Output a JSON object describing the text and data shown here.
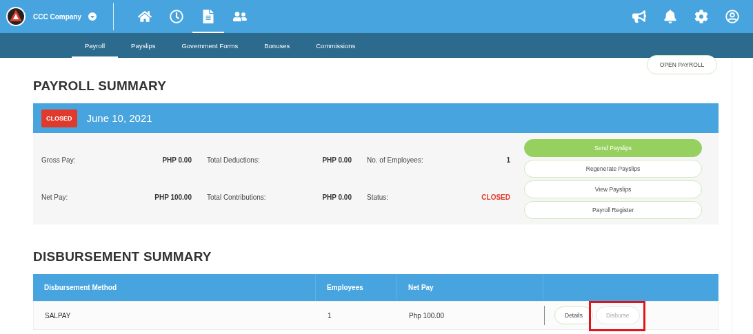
{
  "header": {
    "company": "CCC Company",
    "nav_icons": [
      {
        "kind": "home",
        "selected": false
      },
      {
        "kind": "clock",
        "selected": false
      },
      {
        "kind": "document",
        "selected": true
      },
      {
        "kind": "people",
        "selected": false
      }
    ],
    "right_icons": [
      {
        "kind": "megaphone"
      },
      {
        "kind": "bell"
      },
      {
        "kind": "settings"
      },
      {
        "kind": "account"
      }
    ]
  },
  "tabs": [
    {
      "label": "Payroll",
      "selected": true
    },
    {
      "label": "Payslips",
      "selected": false
    },
    {
      "label": "Government Forms",
      "selected": false
    },
    {
      "label": "Bonuses",
      "selected": false
    },
    {
      "label": "Commissions",
      "selected": false
    }
  ],
  "open_payroll_button": "OPEN PAYROLL",
  "payroll_summary": {
    "title": "PAYROLL SUMMARY",
    "badge": "CLOSED",
    "date": "June 10, 2021",
    "rows": [
      [
        {
          "label": "Gross Pay:",
          "value": "PHP 0.00",
          "kind": "amount"
        },
        {
          "label": "Total Deductions:",
          "value": "PHP 0.00",
          "kind": "amount"
        },
        {
          "label": "No. of Employees:",
          "value": "1",
          "kind": "amount"
        }
      ],
      [
        {
          "label": "Net Pay:",
          "value": "PHP 100.00",
          "kind": "amount"
        },
        {
          "label": "Total Contributions:",
          "value": "PHP 0.00",
          "kind": "amount"
        },
        {
          "label": "Status:",
          "value": "CLOSED",
          "kind": "status"
        }
      ]
    ],
    "actions": [
      {
        "label": "Send Payslips",
        "kind": "primary"
      },
      {
        "label": "Regenerate Payslips",
        "kind": "outline"
      },
      {
        "label": "View Payslips",
        "kind": "outline"
      },
      {
        "label": "Payroll Register",
        "kind": "outline"
      }
    ]
  },
  "disbursement_summary": {
    "title": "DISBURSEMENT SUMMARY",
    "columns": [
      "Disbursement Method",
      "Employees",
      "Net Pay"
    ],
    "rows": [
      {
        "cells": [
          "SALPAY",
          "1",
          "Php 100.00"
        ],
        "actions": [
          {
            "label": "Details",
            "disabled": false,
            "highlighted": false
          },
          {
            "label": "Disburse",
            "disabled": true,
            "highlighted": true
          }
        ]
      }
    ]
  }
}
